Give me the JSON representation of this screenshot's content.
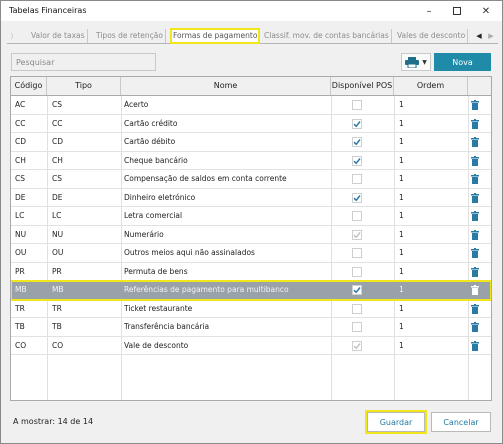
{
  "window": {
    "title": "Tabelas Financeiras"
  },
  "tabs": [
    {
      "label": "Valor de taxas",
      "active": false
    },
    {
      "label": "Tipos de retenção",
      "active": false
    },
    {
      "label": "Formas de pagamento",
      "active": true
    },
    {
      "label": "Classif. mov. de contas bancárias",
      "active": false
    },
    {
      "label": "Vales de desconto",
      "active": false
    }
  ],
  "search": {
    "placeholder": "Pesquisar"
  },
  "toolbar": {
    "print_icon": "printer-icon",
    "new_label": "Nova"
  },
  "table": {
    "columns": [
      "Código",
      "Tipo",
      "Nome",
      "Disponível POS",
      "Ordem"
    ],
    "rows": [
      {
        "codigo": "AC",
        "tipo": "CS",
        "nome": "Acerto",
        "pos": "unchecked",
        "ordem": "1"
      },
      {
        "codigo": "CC",
        "tipo": "CC",
        "nome": "Cartão crédito",
        "pos": "checked",
        "ordem": "1"
      },
      {
        "codigo": "CD",
        "tipo": "CD",
        "nome": "Cartão débito",
        "pos": "checked",
        "ordem": "1"
      },
      {
        "codigo": "CH",
        "tipo": "CH",
        "nome": "Cheque bancário",
        "pos": "checked",
        "ordem": "1"
      },
      {
        "codigo": "CS",
        "tipo": "CS",
        "nome": "Compensação de saldos em conta corrente",
        "pos": "unchecked",
        "ordem": "1"
      },
      {
        "codigo": "DE",
        "tipo": "DE",
        "nome": "Dinheiro eletrónico",
        "pos": "checked",
        "ordem": "1"
      },
      {
        "codigo": "LC",
        "tipo": "LC",
        "nome": "Letra comercial",
        "pos": "unchecked",
        "ordem": "1"
      },
      {
        "codigo": "NU",
        "tipo": "NU",
        "nome": "Numerário",
        "pos": "checked-disabled",
        "ordem": "1"
      },
      {
        "codigo": "OU",
        "tipo": "OU",
        "nome": "Outros meios aqui não assinalados",
        "pos": "unchecked",
        "ordem": "1"
      },
      {
        "codigo": "PR",
        "tipo": "PR",
        "nome": "Permuta de bens",
        "pos": "unchecked",
        "ordem": "1"
      },
      {
        "codigo": "MB",
        "tipo": "MB",
        "nome": "Referências de pagamento para multibanco",
        "pos": "checked",
        "ordem": "1",
        "selected": true
      },
      {
        "codigo": "TR",
        "tipo": "TR",
        "nome": "Ticket restaurante",
        "pos": "unchecked",
        "ordem": "1"
      },
      {
        "codigo": "TB",
        "tipo": "TB",
        "nome": "Transferência bancária",
        "pos": "unchecked",
        "ordem": "1"
      },
      {
        "codigo": "CO",
        "tipo": "CO",
        "nome": "Vale de desconto",
        "pos": "checked-disabled",
        "ordem": "1"
      }
    ]
  },
  "status": {
    "count_text": "A mostrar: 14 de 14"
  },
  "footer": {
    "save_label": "Guardar",
    "cancel_label": "Cancelar"
  },
  "colors": {
    "accent": "#1f8ba8",
    "highlight": "#f1e51c",
    "selected_row": "#99a1a9",
    "check": "#2a7aa6"
  }
}
